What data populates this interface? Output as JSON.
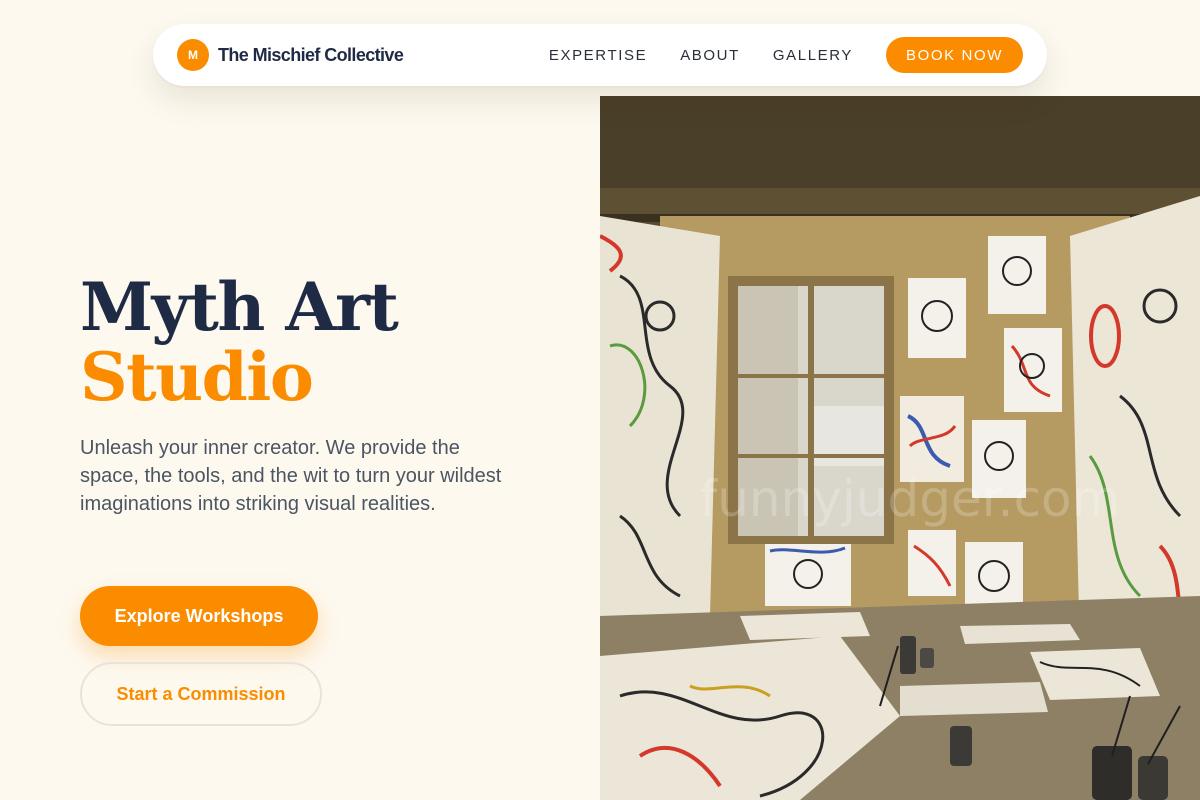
{
  "nav": {
    "logo_letter": "M",
    "brand": "The Mischief Collective",
    "links": [
      "EXPERTISE",
      "ABOUT",
      "GALLERY"
    ],
    "cta": "BOOK NOW"
  },
  "hero": {
    "title_line1": "Myth Art",
    "title_line2": "Studio",
    "description": "Unleash your inner creator. We provide the space, the tools, and the wit to turn your wildest imaginations into striking visual realities.",
    "primary_button": "Explore Workshops",
    "secondary_button": "Start a Commission",
    "image_alt": "Art studio room filled with doodle drawings on walls and floor",
    "watermark": "funnyjudger.com"
  },
  "colors": {
    "accent": "#fb8c00",
    "navy": "#1f2a44",
    "background": "#fdf9ef",
    "body_text": "#4b5563"
  }
}
